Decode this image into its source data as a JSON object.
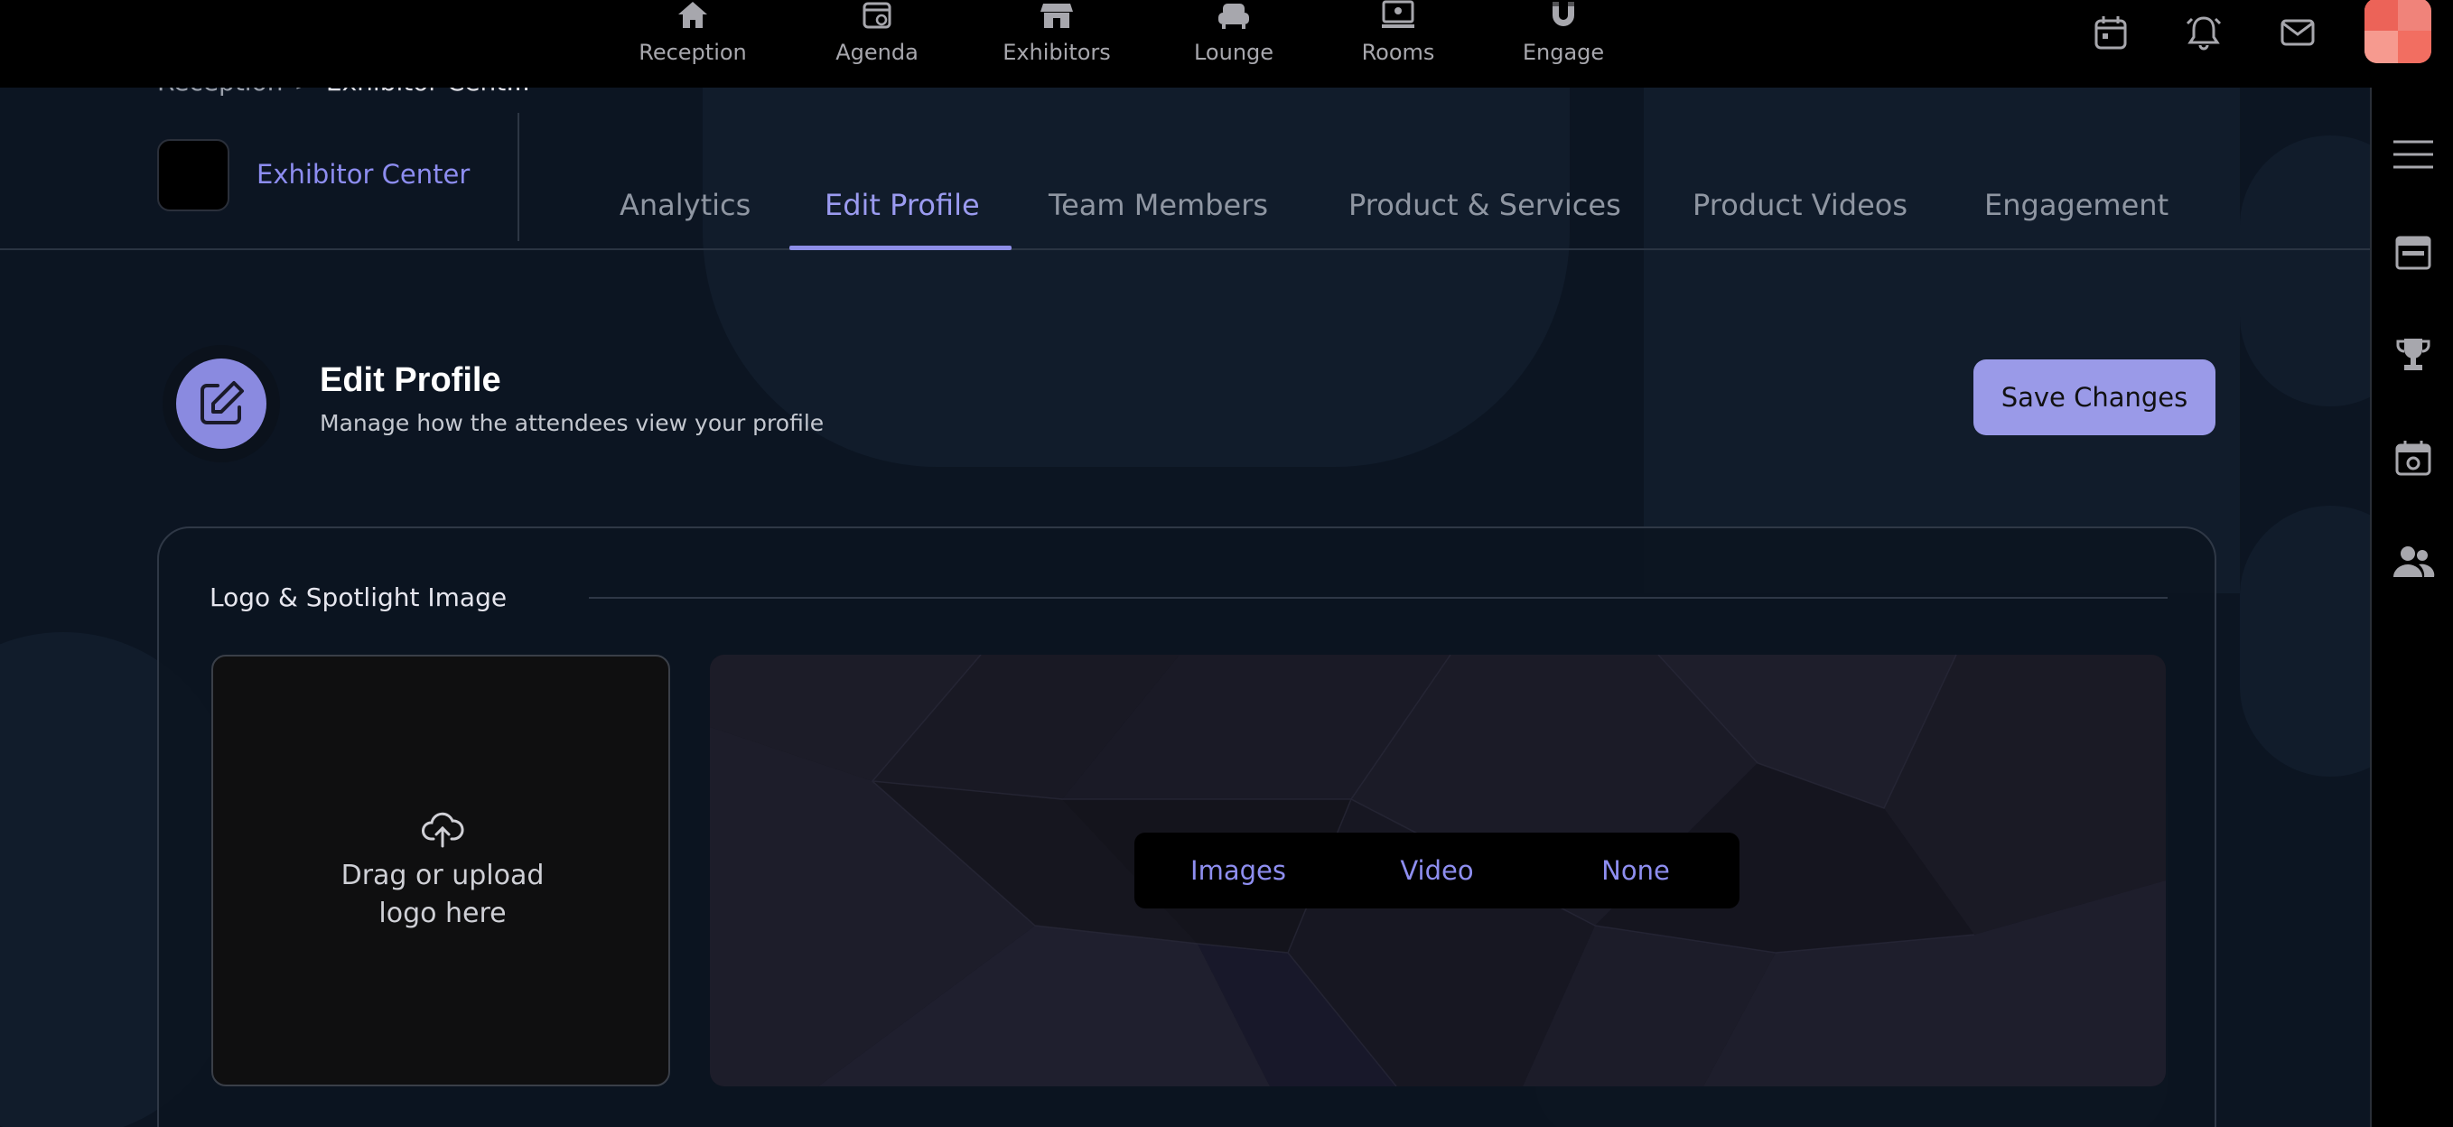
{
  "nav": {
    "items": [
      {
        "label": "Reception",
        "icon": "home-icon"
      },
      {
        "label": "Agenda",
        "icon": "agenda-icon"
      },
      {
        "label": "Exhibitors",
        "icon": "store-icon"
      },
      {
        "label": "Lounge",
        "icon": "armchair-icon"
      },
      {
        "label": "Rooms",
        "icon": "rooms-icon"
      },
      {
        "label": "Engage",
        "icon": "magnet-icon"
      }
    ],
    "right_icons": [
      "calendar-icon",
      "bell-icon",
      "mail-icon"
    ]
  },
  "rail": {
    "icons": [
      "hamburger-menu-icon",
      "browser-window-icon",
      "trophy-icon",
      "calendar-camera-icon",
      "people-icon"
    ]
  },
  "breadcrumb": {
    "root": "Reception",
    "separator": ">",
    "current": "Exhibitor Cent..."
  },
  "exhibitor": {
    "name": "Exhibitor Center"
  },
  "tabs": [
    {
      "label": "Analytics",
      "active": false
    },
    {
      "label": "Edit Profile",
      "active": true
    },
    {
      "label": "Team Members",
      "active": false
    },
    {
      "label": "Product & Services",
      "active": false
    },
    {
      "label": "Product Videos",
      "active": false
    },
    {
      "label": "Engagement",
      "active": false
    }
  ],
  "edit_profile": {
    "title": "Edit Profile",
    "subtitle": "Manage how the attendees view your profile",
    "save_label": "Save Changes"
  },
  "logo_section": {
    "title": "Logo & Spotlight Image",
    "upload_text": "Drag or upload logo here",
    "spotlight_options": [
      "Images",
      "Video",
      "None"
    ]
  },
  "colors": {
    "accent": "#9a9ae8",
    "background": "#0c1522",
    "topbar": "#000000",
    "avatar": "#f0837a"
  }
}
